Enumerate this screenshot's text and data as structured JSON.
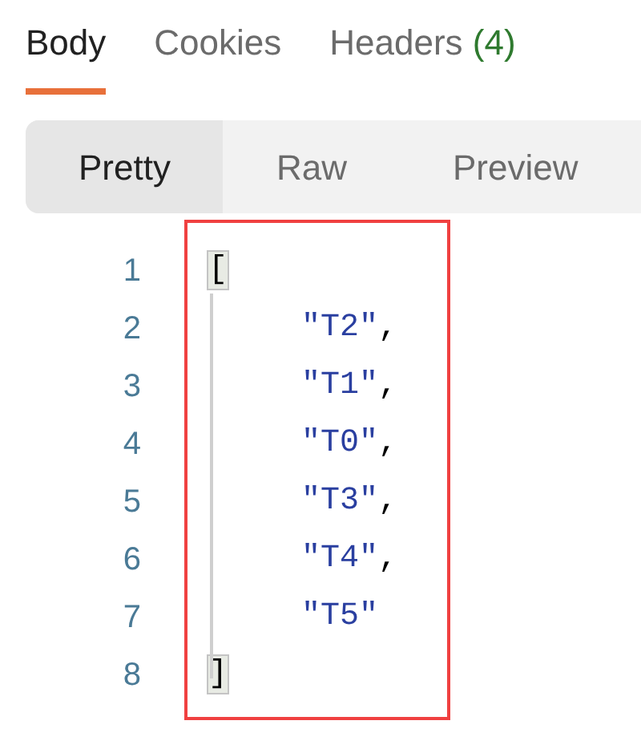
{
  "tabs": [
    {
      "label": "Body",
      "selected": true
    },
    {
      "label": "Cookies",
      "selected": false
    },
    {
      "label": "Headers",
      "count": "(4)",
      "selected": false
    }
  ],
  "view_modes": [
    {
      "label": "Pretty",
      "selected": true
    },
    {
      "label": "Raw",
      "selected": false
    },
    {
      "label": "Preview",
      "selected": false
    }
  ],
  "code": {
    "lines": [
      {
        "number": "1",
        "kind": "delimiter",
        "tokens": [
          {
            "kind": "bracket",
            "text": "["
          }
        ]
      },
      {
        "number": "2",
        "kind": "element",
        "tokens": [
          {
            "kind": "string",
            "text": "\"T2\""
          },
          {
            "kind": "punct",
            "text": ","
          }
        ]
      },
      {
        "number": "3",
        "kind": "element",
        "tokens": [
          {
            "kind": "string",
            "text": "\"T1\""
          },
          {
            "kind": "punct",
            "text": ","
          }
        ]
      },
      {
        "number": "4",
        "kind": "element",
        "tokens": [
          {
            "kind": "string",
            "text": "\"T0\""
          },
          {
            "kind": "punct",
            "text": ","
          }
        ]
      },
      {
        "number": "5",
        "kind": "element",
        "tokens": [
          {
            "kind": "string",
            "text": "\"T3\""
          },
          {
            "kind": "punct",
            "text": ","
          }
        ]
      },
      {
        "number": "6",
        "kind": "element",
        "tokens": [
          {
            "kind": "string",
            "text": "\"T4\""
          },
          {
            "kind": "punct",
            "text": ","
          }
        ]
      },
      {
        "number": "7",
        "kind": "element",
        "tokens": [
          {
            "kind": "string",
            "text": "\"T5\""
          }
        ]
      },
      {
        "number": "8",
        "kind": "delimiter",
        "tokens": [
          {
            "kind": "bracket",
            "text": "]"
          }
        ]
      }
    ]
  }
}
